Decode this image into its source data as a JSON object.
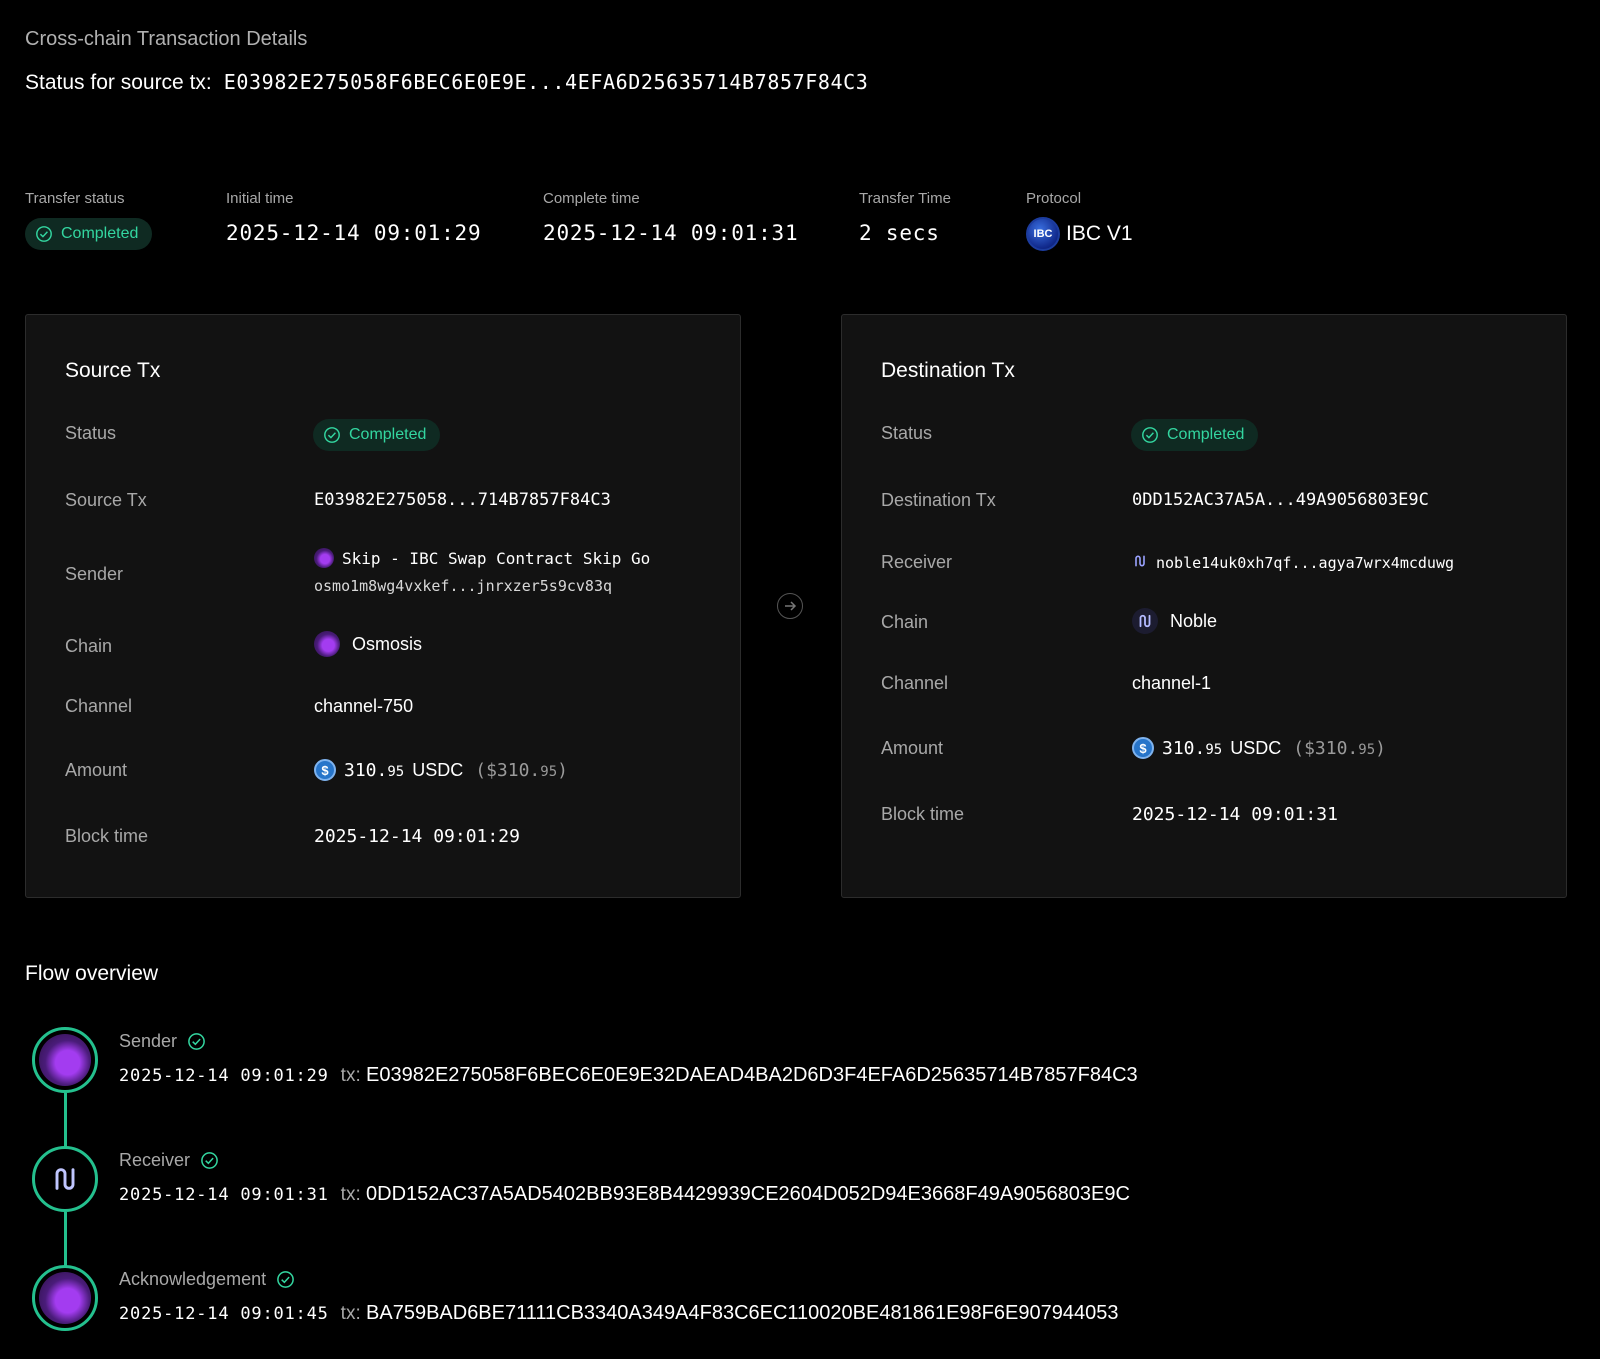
{
  "header": {
    "subtitle": "Cross-chain Transaction Details",
    "title_prefix": "Status for source tx:",
    "title_hash": "E03982E275058F6BEC6E0E9E...4EFA6D25635714B7857F84C3"
  },
  "summary": {
    "transfer_status_label": "Transfer status",
    "transfer_status_value": "Completed",
    "initial_time_label": "Initial time",
    "initial_time_value": "2025-12-14 09:01:29",
    "complete_time_label": "Complete time",
    "complete_time_value": "2025-12-14 09:01:31",
    "transfer_time_label": "Transfer Time",
    "transfer_time_value": "2 secs",
    "protocol_label": "Protocol",
    "protocol_logo": "IBC",
    "protocol_value": "IBC V1"
  },
  "source": {
    "title": "Source Tx",
    "status_label": "Status",
    "status_value": "Completed",
    "tx_label": "Source Tx",
    "tx_value": "E03982E275058...714B7857F84C3",
    "sender_label": "Sender",
    "sender_name": "Skip - IBC Swap Contract Skip Go",
    "sender_address": "osmo1m8wg4vxkef...jnrxzer5s9cv83q",
    "chain_label": "Chain",
    "chain_value": "Osmosis",
    "channel_label": "Channel",
    "channel_value": "channel-750",
    "amount_label": "Amount",
    "amount_int": "310.",
    "amount_dec": "95",
    "amount_token": "USDC",
    "amount_usd_open": "($310.",
    "amount_usd_dec": "95",
    "amount_usd_close": ")",
    "block_time_label": "Block time",
    "block_time_value": "2025-12-14 09:01:29"
  },
  "destination": {
    "title": "Destination Tx",
    "status_label": "Status",
    "status_value": "Completed",
    "tx_label": "Destination Tx",
    "tx_value": "0DD152AC37A5A...49A9056803E9C",
    "receiver_label": "Receiver",
    "receiver_address": "noble14uk0xh7qf...agya7wrx4mcduwg",
    "chain_label": "Chain",
    "chain_value": "Noble",
    "channel_label": "Channel",
    "channel_value": "channel-1",
    "amount_label": "Amount",
    "amount_int": "310.",
    "amount_dec": "95",
    "amount_token": "USDC",
    "amount_usd_open": "($310.",
    "amount_usd_dec": "95",
    "amount_usd_close": ")",
    "block_time_label": "Block time",
    "block_time_value": "2025-12-14 09:01:31"
  },
  "flow": {
    "title": "Flow overview",
    "steps": [
      {
        "label": "Sender",
        "time": "2025-12-14 09:01:29",
        "tx_label": "tx:",
        "tx": "E03982E275058F6BEC6E0E9E32DAEAD4BA2D6D3F4EFA6D25635714B7857F84C3",
        "icon": "osmosis-icon"
      },
      {
        "label": "Receiver",
        "time": "2025-12-14 09:01:31",
        "tx_label": "tx:",
        "tx": "0DD152AC37A5AD5402BB93E8B4429939CE2604D052D94E3668F49A9056803E9C",
        "icon": "noble-icon"
      },
      {
        "label": "Acknowledgement",
        "time": "2025-12-14 09:01:45",
        "tx_label": "tx:",
        "tx": "BA759BAD6BE71111CB3340A349A4F83C6EC110020BE481861E98F6E907944053",
        "icon": "osmosis-icon"
      }
    ]
  },
  "colors": {
    "background": "#000000",
    "card": "#121212",
    "accent_green": "#33d6a0",
    "badge_bg": "#0f2a22",
    "muted_text": "#a8a8a8"
  }
}
